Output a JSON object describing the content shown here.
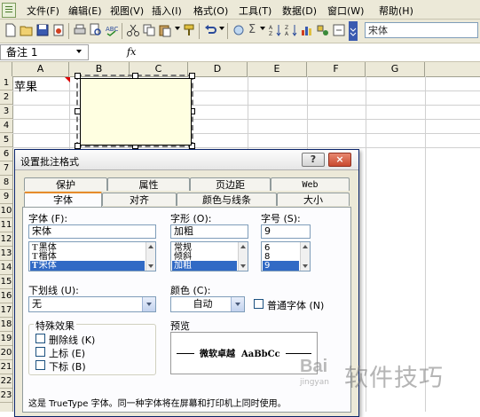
{
  "menu": [
    "文件(F)",
    "编辑(E)",
    "视图(V)",
    "插入(I)",
    "格式(O)",
    "工具(T)",
    "数据(D)",
    "窗口(W)",
    "帮助(H)"
  ],
  "toolbar": {
    "font_name": "宋体",
    "sigma": "Σ"
  },
  "formula_bar": {
    "name_box": "备注 1",
    "fx": "fx"
  },
  "columns": [
    "A",
    "B",
    "C",
    "D",
    "E",
    "F",
    "G"
  ],
  "rows": [
    "1",
    "2",
    "3",
    "4",
    "5",
    "6",
    "7",
    "8",
    "9",
    "10",
    "11",
    "12",
    "13",
    "14",
    "15",
    "16",
    "17",
    "18",
    "19",
    "20",
    "21",
    "22",
    "23"
  ],
  "cell_a1": "苹果",
  "dialog": {
    "title": "设置批注格式",
    "help": "?",
    "close": "×",
    "tabs_back": [
      "保护",
      "属性",
      "页边距",
      "Web"
    ],
    "tabs_front": [
      "字体",
      "对齐",
      "颜色与线条",
      "大小"
    ],
    "selected_tab": "字体",
    "font_label": "字体 (F):",
    "font_value": "宋体",
    "font_list": [
      "黑体",
      "楷体",
      "宋体"
    ],
    "font_list_selected": 2,
    "style_label": "字形 (O):",
    "style_value": "加粗",
    "style_list": [
      "常规",
      "倾斜",
      "加粗"
    ],
    "style_list_selected": 2,
    "size_label": "字号 (S):",
    "size_value": "9",
    "size_list": [
      "6",
      "8",
      "9"
    ],
    "size_list_selected": 2,
    "underline_label": "下划线 (U):",
    "underline_value": "无",
    "color_label": "颜色 (C):",
    "color_value": "自动",
    "normal_font_label": "普通字体 (N)",
    "effects_label": "特殊效果",
    "strikethrough_label": "删除线 (K)",
    "superscript_label": "上标 (E)",
    "subscript_label": "下标 (B)",
    "preview_label": "预览",
    "preview_text": "微软卓越  AaBbCc",
    "info_text": "这是 TrueType 字体。同一种字体将在屏幕和打印机上同时使用。"
  },
  "watermark": {
    "brand": "Bai",
    "sub": "jingyan",
    "text": "软件技巧"
  }
}
